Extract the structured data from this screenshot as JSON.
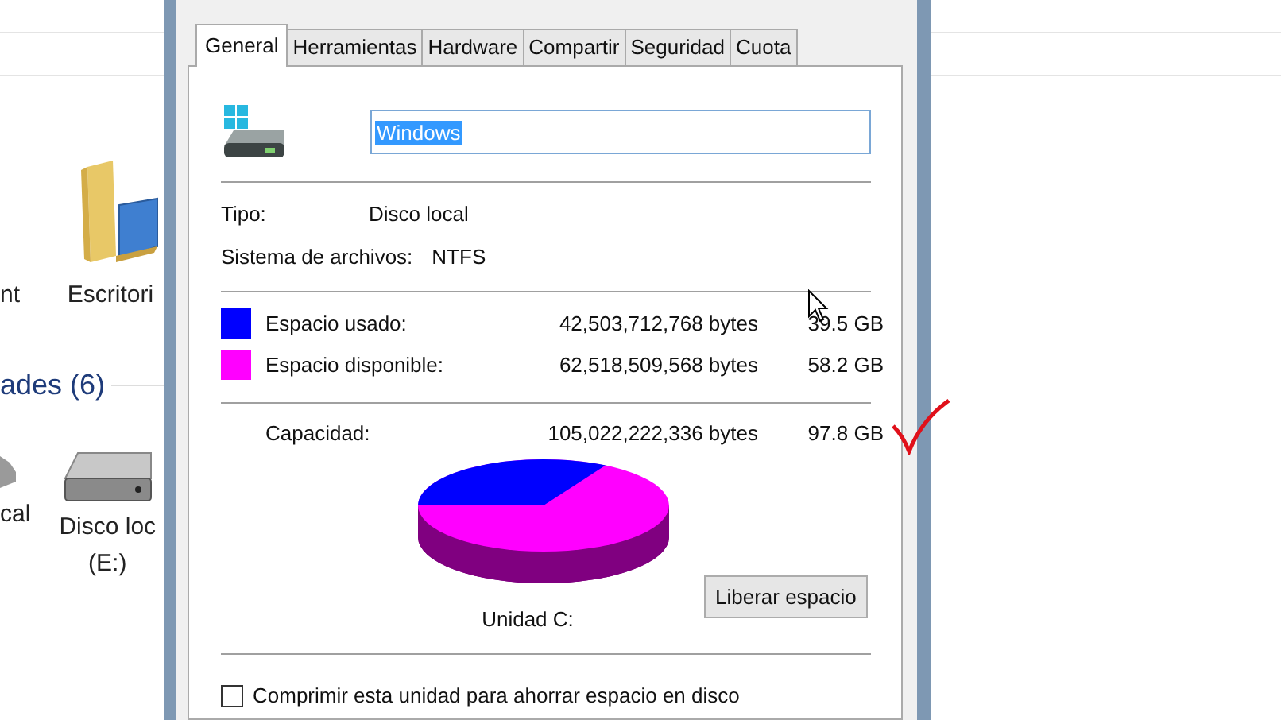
{
  "explorer_left": {
    "items": [
      {
        "label": "nt"
      },
      {
        "label": "Escritori"
      }
    ],
    "section_header": "ades (6)",
    "drives": [
      {
        "label": "cal"
      },
      {
        "label": "Disco loc",
        "sublabel": "(E:)"
      }
    ]
  },
  "dialog": {
    "tabs": [
      {
        "label": "General",
        "selected": true
      },
      {
        "label": "Herramientas",
        "selected": false
      },
      {
        "label": "Hardware",
        "selected": false
      },
      {
        "label": "Compartir",
        "selected": false
      },
      {
        "label": "Seguridad",
        "selected": false
      },
      {
        "label": "Cuota",
        "selected": false
      }
    ],
    "drive_name": "Windows",
    "properties": [
      {
        "label": "Tipo:",
        "value": "Disco local"
      },
      {
        "label": "Sistema de archivos:",
        "value": "NTFS"
      }
    ],
    "space": [
      {
        "label": "Espacio usado:",
        "bytes": "42,503,712,768 bytes",
        "size": "39.5 GB",
        "color": "#0000ff"
      },
      {
        "label": "Espacio disponible:",
        "bytes": "62,518,509,568 bytes",
        "size": "58.2 GB",
        "color": "#ff00ff"
      }
    ],
    "capacity": {
      "label": "Capacidad:",
      "bytes": "105,022,222,336 bytes",
      "size": "97.8 GB"
    },
    "drive_label": "Unidad C:",
    "cleanup_button": "Liberar espacio",
    "compress": {
      "label": "Comprimir esta unidad para ahorrar espacio en disco",
      "checked": false
    }
  }
}
